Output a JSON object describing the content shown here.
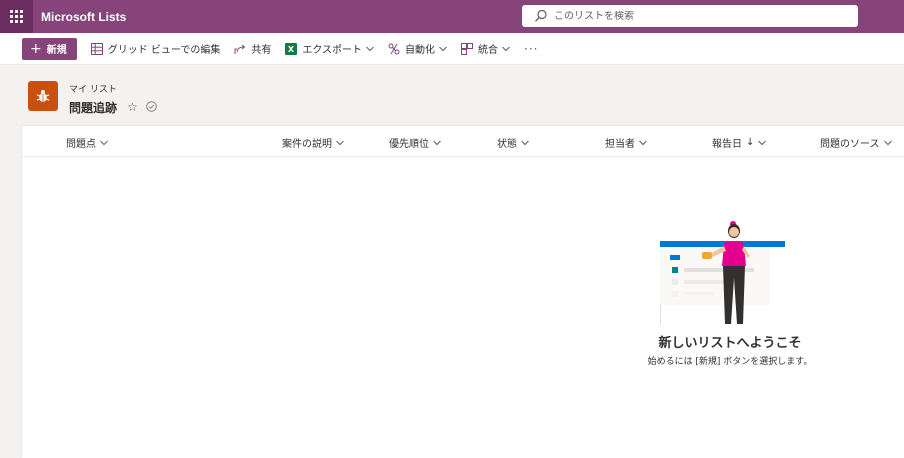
{
  "app": {
    "title": "Microsoft Lists"
  },
  "search": {
    "placeholder": "このリストを検索"
  },
  "toolbar": {
    "new_label": "新規",
    "grid_edit_label": "グリッド ビューでの編集",
    "share_label": "共有",
    "export_label": "エクスポート",
    "automate_label": "自動化",
    "integrate_label": "統合",
    "more_label": "···"
  },
  "header": {
    "breadcrumb": "マイ リスト",
    "title": "問題追跡",
    "logo_color": "#ca5010"
  },
  "columns": [
    {
      "label": "問題点"
    },
    {
      "label": "案件の説明"
    },
    {
      "label": "優先順位"
    },
    {
      "label": "状態"
    },
    {
      "label": "担当者"
    },
    {
      "label": "報告日",
      "sort": "↓"
    },
    {
      "label": "問題のソース"
    }
  ],
  "empty_state": {
    "title": "新しいリストへようこそ",
    "subtitle": "始めるには [新規] ボタンを選択します。"
  },
  "colors": {
    "suite_bar": "#87447b",
    "waffle": "#6b2d60",
    "accent": "#87447b"
  }
}
